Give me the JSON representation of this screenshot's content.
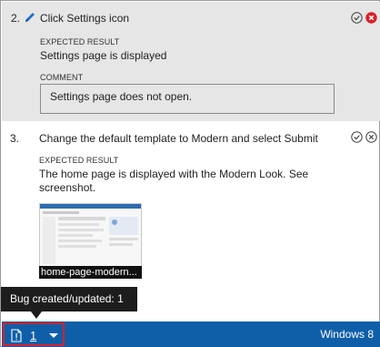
{
  "step2": {
    "number": "2.",
    "title": "Click Settings icon",
    "expected_caption": "EXPECTED RESULT",
    "expected": "Settings page is displayed",
    "comment_caption": "COMMENT",
    "comment": "Settings page does not open."
  },
  "step3": {
    "number": "3.",
    "title": "Change the default template to Modern and select Submit",
    "expected_caption": "EXPECTED RESULT",
    "expected": "The home page is displayed with the Modern Look. See screenshot.",
    "attachment_name": "home-page-modern..."
  },
  "tooltip": {
    "text": "Bug created/updated: 1"
  },
  "statusbar": {
    "bug_count": "1",
    "os": "Windows 8"
  },
  "colors": {
    "statusbar": "#0f5fa8",
    "fail_red": "#d9202a",
    "step_fail_bg": "#e6e6e6",
    "pencil_blue": "#1e6fc7"
  }
}
